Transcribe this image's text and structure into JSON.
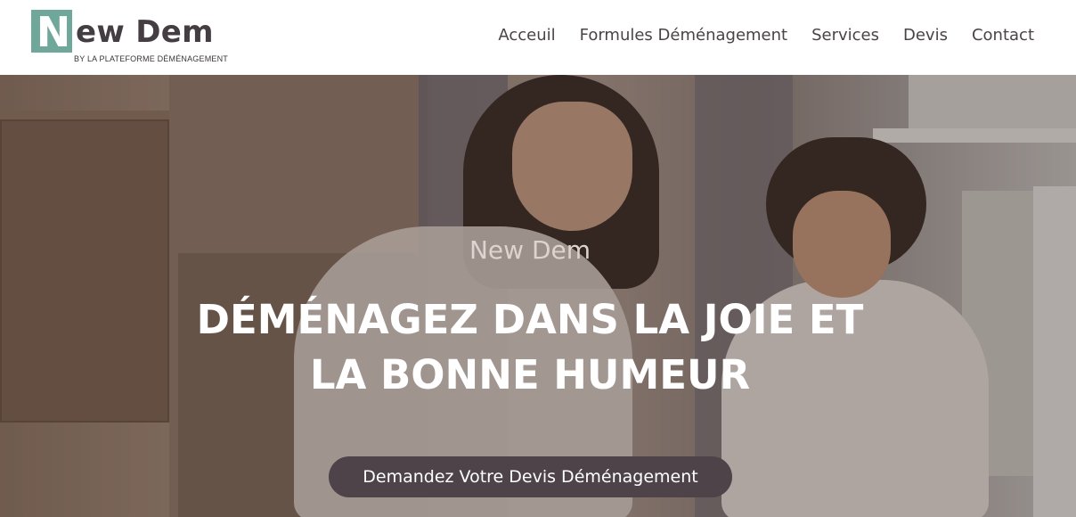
{
  "header": {
    "logo": {
      "initial": "N",
      "rest": "ew Dem",
      "tagline": "BY LA PLATEFORME DÉMÉNAGEMENT"
    },
    "nav": [
      {
        "label": "Acceuil"
      },
      {
        "label": "Formules Déménagement"
      },
      {
        "label": "Services"
      },
      {
        "label": "Devis"
      },
      {
        "label": "Contact"
      }
    ]
  },
  "hero": {
    "subtitle": "New Dem",
    "title_line1": "DÉMÉNAGEZ DANS LA JOIE ET",
    "title_line2": "LA BONNE HUMEUR",
    "cta_label": "Demandez Votre Devis Déménagement"
  },
  "colors": {
    "brand_green": "#6fa79a",
    "text_dark": "#443d42",
    "cta_background": "#4d4348"
  }
}
